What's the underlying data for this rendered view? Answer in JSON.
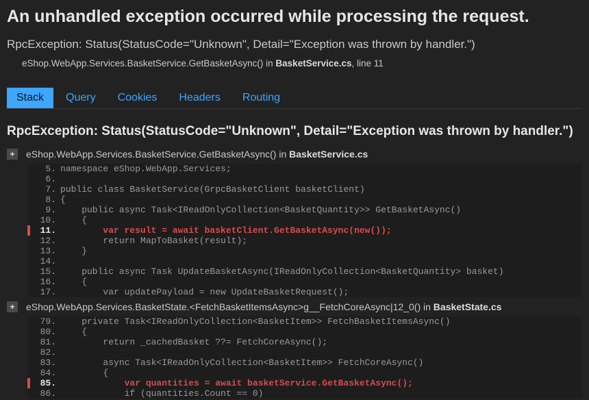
{
  "page_title": "An unhandled exception occurred while processing the request.",
  "exception_summary": "RpcException: Status(StatusCode=\"Unknown\", Detail=\"Exception was thrown by handler.\")",
  "top_frame": {
    "method": "eShop.WebApp.Services.BasketService.GetBasketAsync() in ",
    "file": "BasketService.cs",
    "suffix": ", line 11"
  },
  "tabs": {
    "items": [
      "Stack",
      "Query",
      "Cookies",
      "Headers",
      "Routing"
    ],
    "selected": 0
  },
  "exception_detail": "RpcException: Status(StatusCode=\"Unknown\", Detail=\"Exception was thrown by handler.\")",
  "expander_label": "+",
  "frames": [
    {
      "header_method": "eShop.WebApp.Services.BasketService.GetBasketAsync() in ",
      "header_file": "BasketService.cs",
      "highlight_line": "11",
      "lines": [
        {
          "n": "5",
          "t": "namespace eShop.WebApp.Services;"
        },
        {
          "n": "6",
          "t": ""
        },
        {
          "n": "7",
          "t": "public class BasketService(GrpcBasketClient basketClient)"
        },
        {
          "n": "8",
          "t": "{"
        },
        {
          "n": "9",
          "t": "    public async Task<IReadOnlyCollection<BasketQuantity>> GetBasketAsync()"
        },
        {
          "n": "10",
          "t": "    {"
        },
        {
          "n": "11",
          "t": "        var result = await basketClient.GetBasketAsync(new());"
        },
        {
          "n": "12",
          "t": "        return MapToBasket(result);"
        },
        {
          "n": "13",
          "t": "    }"
        },
        {
          "n": "14",
          "t": ""
        },
        {
          "n": "15",
          "t": "    public async Task UpdateBasketAsync(IReadOnlyCollection<BasketQuantity> basket)"
        },
        {
          "n": "16",
          "t": "    {"
        },
        {
          "n": "17",
          "t": "        var updatePayload = new UpdateBasketRequest();"
        }
      ]
    },
    {
      "header_method": "eShop.WebApp.Services.BasketState.<FetchBasketItemsAsync>g__FetchCoreAsync|12_0() in ",
      "header_file": "BasketState.cs",
      "highlight_line": "85",
      "lines": [
        {
          "n": "79",
          "t": "    private Task<IReadOnlyCollection<BasketItem>> FetchBasketItemsAsync()"
        },
        {
          "n": "80",
          "t": "    {"
        },
        {
          "n": "81",
          "t": "        return _cachedBasket ??= FetchCoreAsync();"
        },
        {
          "n": "82",
          "t": ""
        },
        {
          "n": "83",
          "t": "        async Task<IReadOnlyCollection<BasketItem>> FetchCoreAsync()"
        },
        {
          "n": "84",
          "t": "        {"
        },
        {
          "n": "85",
          "t": "            var quantities = await basketService.GetBasketAsync();"
        },
        {
          "n": "86",
          "t": "            if (quantities.Count == 0)"
        }
      ]
    }
  ]
}
